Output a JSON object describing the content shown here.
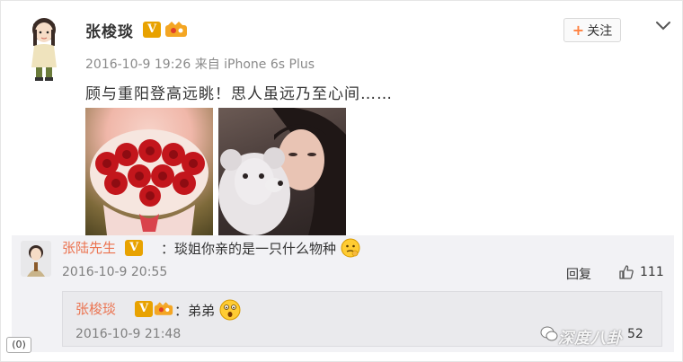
{
  "post": {
    "author": "张梭琰",
    "verified_badge": "V",
    "follow_label": "关注",
    "meta": "2016-10-9 19:26 来自 iPhone 6s Plus",
    "text": "顾与重阳登高远眺！思人虽远乃至心间……",
    "photos": [
      "roses-photo",
      "teddy-bear-selfie-photo"
    ]
  },
  "comments": [
    {
      "author": "张陆先生",
      "verified_badge": "V",
      "text": "：琰姐你亲的是一只什么物种",
      "time": "2016-10-9 20:55",
      "reply_label": "回复",
      "likes": "111"
    }
  ],
  "reply": {
    "author": "张梭琰",
    "verified_badge": "V",
    "text": "：弟弟",
    "time": "2016-10-9 21:48",
    "count": "52"
  },
  "watermark": "深度八卦",
  "corner_tag": "(0)",
  "colors": {
    "username_orange": "#eb7350",
    "badge_gold": "#e8a200",
    "follow_plus": "#ff8140"
  }
}
